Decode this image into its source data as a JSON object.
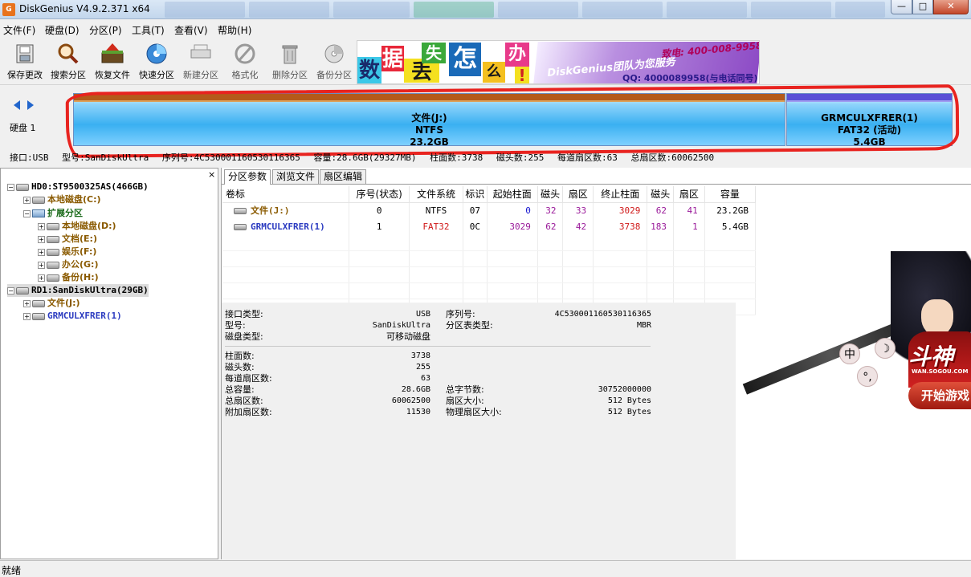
{
  "window": {
    "title": "DiskGenius V4.9.2.371 x64",
    "app_icon_text": "G",
    "min_label": "—",
    "max_label": "□",
    "close_label": "✕"
  },
  "menu": [
    "文件(F)",
    "硬盘(D)",
    "分区(P)",
    "工具(T)",
    "查看(V)",
    "帮助(H)"
  ],
  "toolbar": [
    {
      "label": "保存更改",
      "icon": "save-icon"
    },
    {
      "label": "搜索分区",
      "icon": "search-icon"
    },
    {
      "label": "恢复文件",
      "icon": "recover-icon"
    },
    {
      "label": "快速分区",
      "icon": "quick-partition-icon"
    },
    {
      "label": "新建分区",
      "icon": "new-partition-icon"
    },
    {
      "label": "格式化",
      "icon": "format-icon"
    },
    {
      "label": "删除分区",
      "icon": "delete-icon"
    },
    {
      "label": "备份分区",
      "icon": "backup-icon"
    }
  ],
  "banner": {
    "chars": [
      "数",
      "据",
      "丢",
      "失",
      "怎",
      "么",
      "办",
      "!"
    ],
    "title": "DiskGenius团队为您服务",
    "phone": "致电: 400-008-9958",
    "qq": "QQ: 4000089958(与电话同号)"
  },
  "diskmap": {
    "disk_label": "硬盘 1",
    "partitions": [
      {
        "name": "文件(J:)",
        "fs": "NTFS",
        "size": "23.2GB"
      },
      {
        "name": "GRMCULXFRER(1)",
        "fs": "FAT32 (活动)",
        "size": "5.4GB"
      }
    ],
    "info_line": [
      "接口:USB",
      "型号:SanDiskUltra",
      "序列号:4C530001160530116365",
      "容量:28.6GB(29327MB)",
      "柱面数:3738",
      "磁头数:255",
      "每道扇区数:63",
      "总扇区数:60062500"
    ]
  },
  "tree": {
    "close_label": "×",
    "items": [
      {
        "text": "HD0:ST9500325AS(466GB)",
        "level": 0,
        "kind": "disk"
      },
      {
        "text": "本地磁盘(C:)",
        "level": 1,
        "kind": "brown"
      },
      {
        "text": "扩展分区",
        "level": 1,
        "kind": "green"
      },
      {
        "text": "本地磁盘(D:)",
        "level": 2,
        "kind": "brown"
      },
      {
        "text": "文档(E:)",
        "level": 2,
        "kind": "brown"
      },
      {
        "text": "娱乐(F:)",
        "level": 2,
        "kind": "brown"
      },
      {
        "text": "办公(G:)",
        "level": 2,
        "kind": "brown"
      },
      {
        "text": "备份(H:)",
        "level": 2,
        "kind": "brown"
      },
      {
        "text": "RD1:SanDiskUltra(29GB)",
        "level": 0,
        "kind": "disk"
      },
      {
        "text": "文件(J:)",
        "level": 1,
        "kind": "brown"
      },
      {
        "text": "GRMCULXFRER(1)",
        "level": 1,
        "kind": "blue"
      }
    ]
  },
  "tabs": [
    "分区参数",
    "浏览文件",
    "扇区编辑"
  ],
  "table": {
    "headers": [
      "卷标",
      "序号(状态)",
      "文件系统",
      "标识",
      "起始柱面",
      "磁头",
      "扇区",
      "终止柱面",
      "磁头",
      "扇区",
      "容量"
    ],
    "rows": [
      [
        "文件(J:)",
        "0",
        "NTFS",
        "07",
        "0",
        "32",
        "33",
        "3029",
        "62",
        "41",
        "23.2GB"
      ],
      [
        "GRMCULXFRER(1)",
        "1",
        "FAT32",
        "0C",
        "3029",
        "62",
        "42",
        "3738",
        "183",
        "1",
        "5.4GB"
      ]
    ]
  },
  "info": {
    "interface_label": "接口类型:",
    "interface_value": "USB",
    "serial_label": "序列号:",
    "serial_value": "4C530001160530116365",
    "model_label": "型号:",
    "model_value": "SanDiskUltra",
    "ptable_label": "分区表类型:",
    "ptable_value": "MBR",
    "disktype_label": "磁盘类型:",
    "disktype_value": "可移动磁盘",
    "cyl_label": "柱面数:",
    "cyl_value": "3738",
    "heads_label": "磁头数:",
    "heads_value": "255",
    "spt_label": "每道扇区数:",
    "spt_value": "63",
    "cap_label": "总容量:",
    "cap_value": "28.6GB",
    "bytes_label": "总字节数:",
    "bytes_value": "30752000000",
    "sectors_label": "总扇区数:",
    "sectors_value": "60062500",
    "secsize_label": "扇区大小:",
    "secsize_value": "512 Bytes",
    "extra_label": "附加扇区数:",
    "extra_value": "11530",
    "physsec_label": "物理扇区大小:",
    "physsec_value": "512 Bytes"
  },
  "ad": {
    "logo": "斗神",
    "site": "WAN.SOGOU.COM",
    "start_label": "开始游戏",
    "bubble1": "中",
    "bubble2": "☽",
    "bubble3": "°,"
  },
  "status": "就绪"
}
